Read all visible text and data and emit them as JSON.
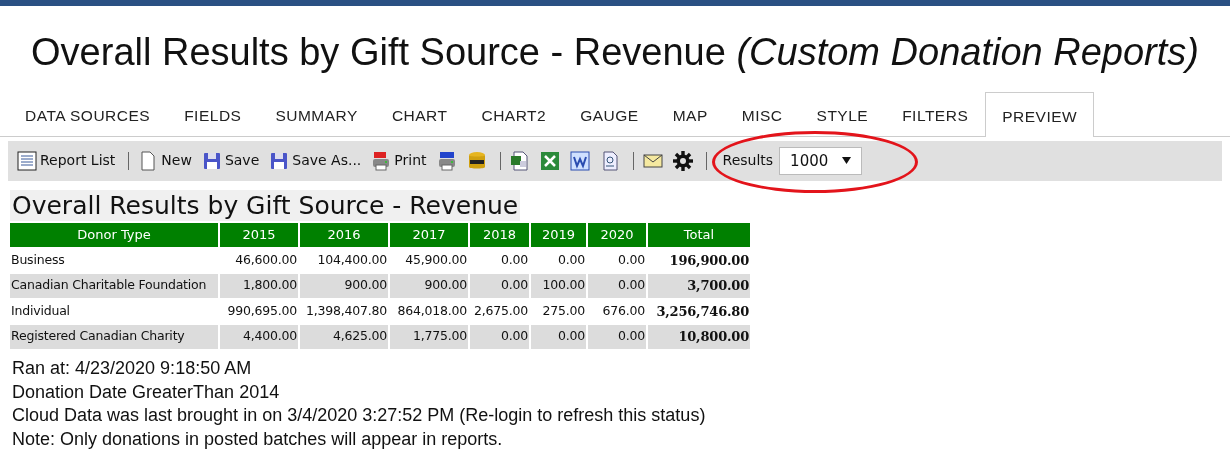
{
  "page_title": {
    "main": "Overall Results by Gift Source - Revenue",
    "subtitle": "(Custom Donation Reports)"
  },
  "tabs": [
    {
      "label": "DATA SOURCES",
      "selected": false
    },
    {
      "label": "FIELDS",
      "selected": false
    },
    {
      "label": "SUMMARY",
      "selected": false
    },
    {
      "label": "CHART",
      "selected": false
    },
    {
      "label": "CHART2",
      "selected": false
    },
    {
      "label": "GAUGE",
      "selected": false
    },
    {
      "label": "MAP",
      "selected": false
    },
    {
      "label": "MISC",
      "selected": false
    },
    {
      "label": "STYLE",
      "selected": false
    },
    {
      "label": "FILTERS",
      "selected": false
    },
    {
      "label": "PREVIEW",
      "selected": true
    }
  ],
  "toolbar": [
    {
      "kind": "button",
      "label": "Report List"
    },
    {
      "kind": "separator"
    },
    {
      "kind": "button",
      "label": "New"
    },
    {
      "kind": "button",
      "label": "Save"
    },
    {
      "kind": "button",
      "label": "Save As..."
    },
    {
      "kind": "button",
      "label": "Print"
    },
    {
      "kind": "button"
    },
    {
      "kind": "button"
    },
    {
      "kind": "separator"
    },
    {
      "kind": "button"
    },
    {
      "kind": "button"
    },
    {
      "kind": "button"
    },
    {
      "kind": "button"
    },
    {
      "kind": "separator"
    },
    {
      "kind": "button"
    },
    {
      "kind": "button"
    },
    {
      "kind": "separator"
    },
    {
      "kind": "results",
      "label": "Results",
      "value": "1000"
    }
  ],
  "annotations": [
    {
      "kind": "ellipse"
    }
  ],
  "report_title": "Overall Results by Gift Source - Revenue",
  "table": {
    "columns": [
      "Donor Type",
      "2015",
      "2016",
      "2017",
      "2018",
      "2019",
      "2020",
      "Total"
    ],
    "rows": [
      [
        "Business",
        "46,600.00",
        "104,400.00",
        "45,900.00",
        "0.00",
        "0.00",
        "0.00",
        "196,900.00"
      ],
      [
        "Canadian Charitable Foundation",
        "1,800.00",
        "900.00",
        "900.00",
        "0.00",
        "100.00",
        "0.00",
        "3,700.00"
      ],
      [
        "Individual",
        "990,695.00",
        "1,398,407.80",
        "864,018.00",
        "2,675.00",
        "275.00",
        "676.00",
        "3,256,746.80"
      ],
      [
        "Registered Canadian Charity",
        "4,400.00",
        "4,625.00",
        "1,775.00",
        "0.00",
        "0.00",
        "0.00",
        "10,800.00"
      ]
    ]
  },
  "notes": [
    "Ran at: 4/23/2020 9:18:50 AM",
    "Donation Date GreaterThan 2014",
    "Cloud Data was last brought in on 3/4/2020 3:27:52 PM (Re-login to refresh this status)",
    "Note: Only donations in posted batches will appear in reports."
  ]
}
